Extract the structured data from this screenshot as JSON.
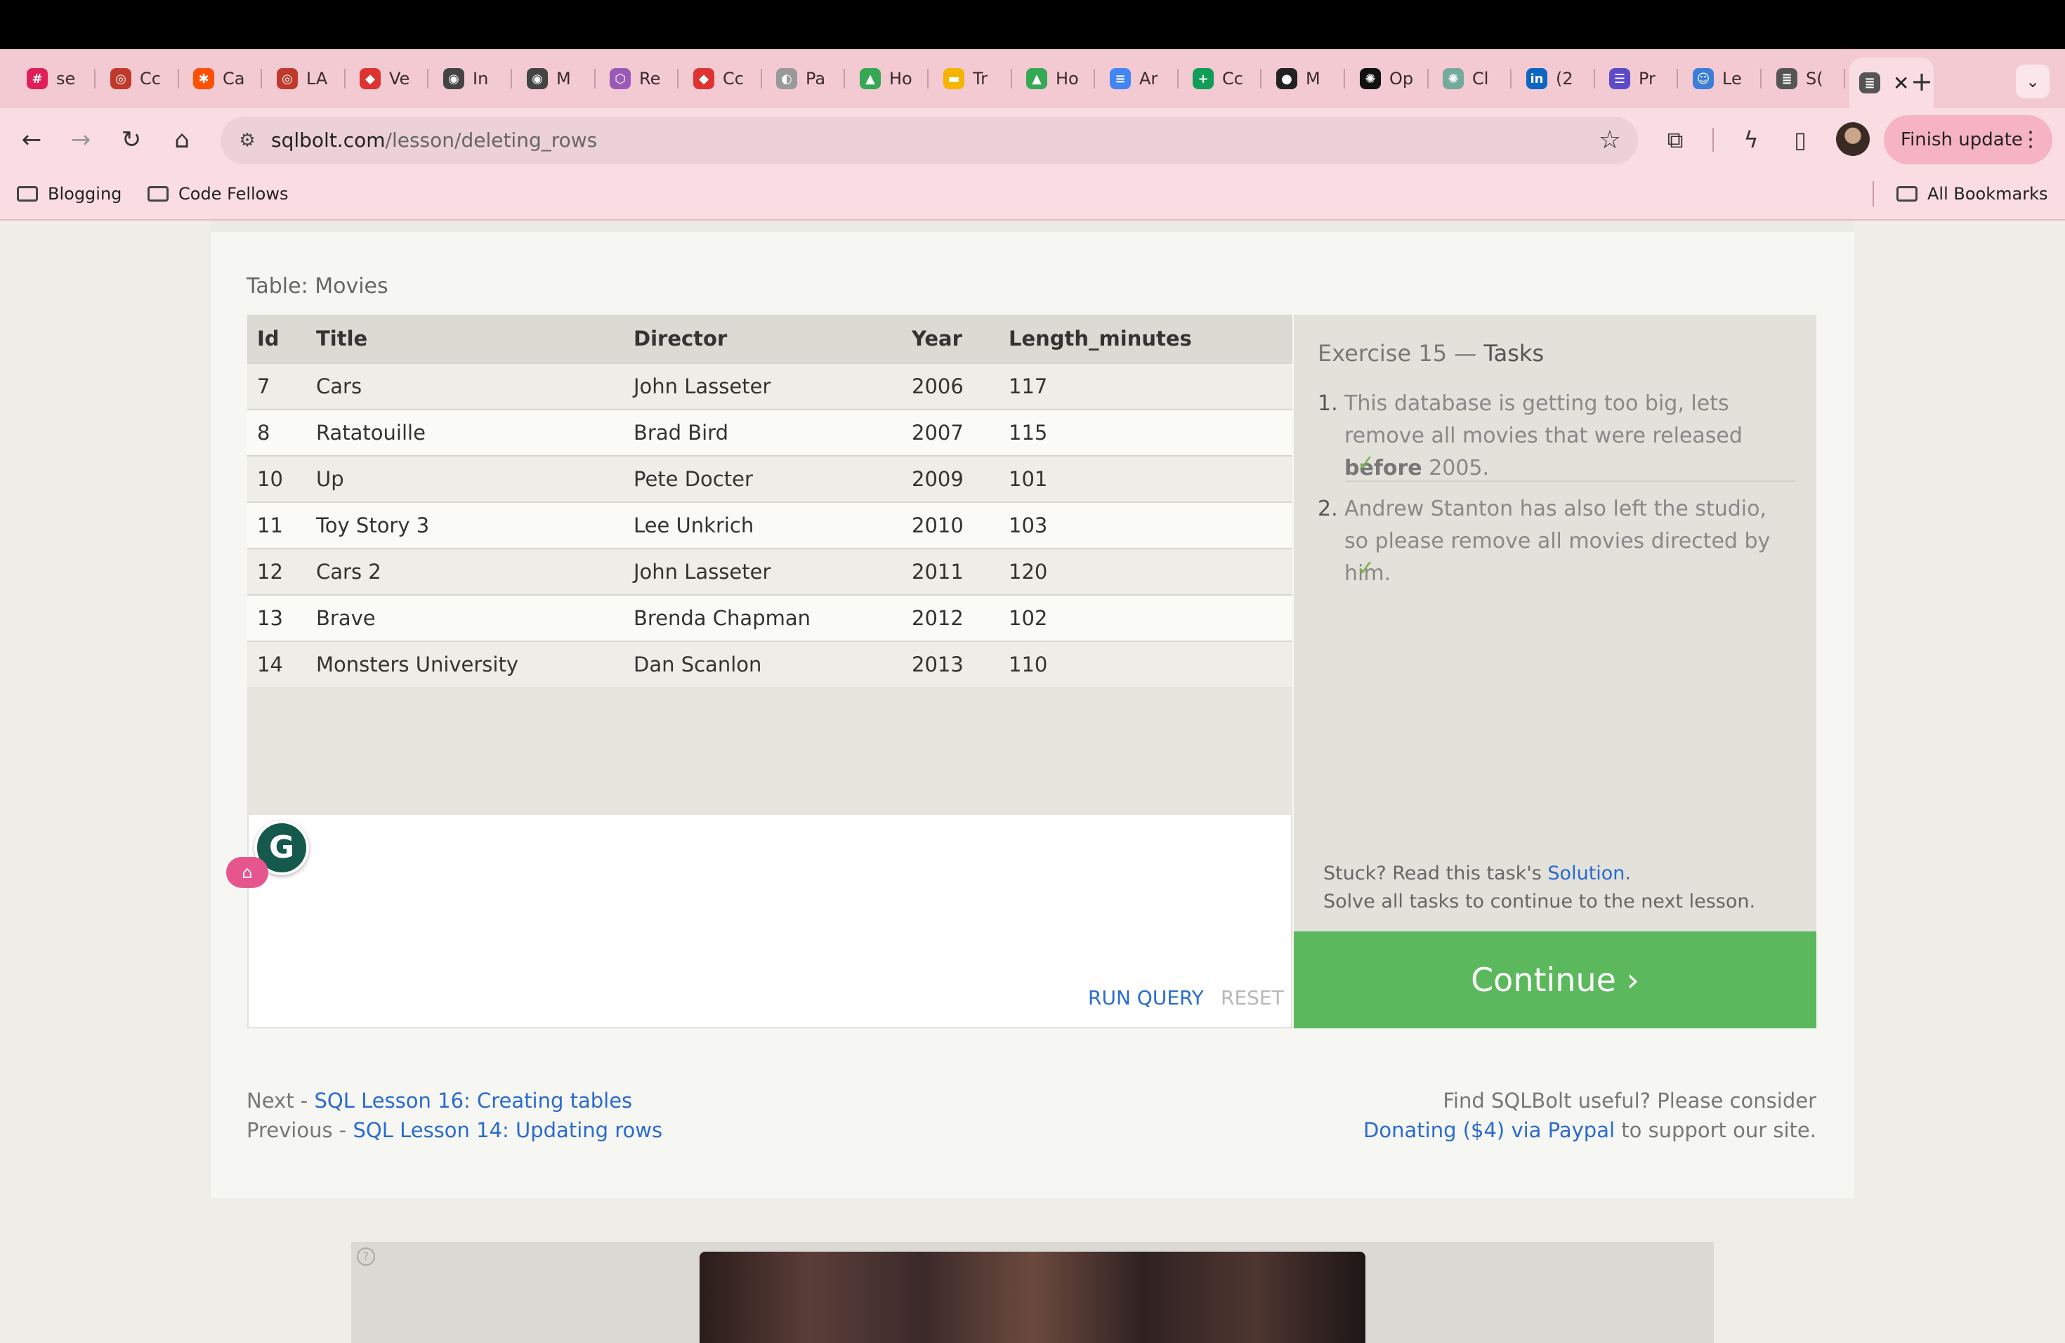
{
  "browser": {
    "tabs": [
      {
        "title": "se",
        "icon": "slack-icon",
        "color": "#e01e5a"
      },
      {
        "title": "Cc",
        "icon": "target-icon",
        "color": "#c0392b"
      },
      {
        "title": "Ca",
        "icon": "zapier-icon",
        "color": "#ff4f00"
      },
      {
        "title": "LA",
        "icon": "target-icon",
        "color": "#c0392b"
      },
      {
        "title": "Ve",
        "icon": "shield-code-icon",
        "color": "#d33"
      },
      {
        "title": "In",
        "icon": "openai-ring-icon",
        "color": "#444"
      },
      {
        "title": "M",
        "icon": "openai-ring-icon",
        "color": "#444"
      },
      {
        "title": "Re",
        "icon": "cube-icon",
        "color": "#9b59b6"
      },
      {
        "title": "Cc",
        "icon": "shield-code-icon",
        "color": "#d33"
      },
      {
        "title": "Pa",
        "icon": "globe-icon",
        "color": "#999"
      },
      {
        "title": "Ho",
        "icon": "drive-icon",
        "color": "#34a853"
      },
      {
        "title": "Tr",
        "icon": "slides-icon",
        "color": "#f4b400"
      },
      {
        "title": "Ho",
        "icon": "drive-icon",
        "color": "#34a853"
      },
      {
        "title": "Ar",
        "icon": "docs-icon",
        "color": "#4285f4"
      },
      {
        "title": "Cc",
        "icon": "sheets-plus-icon",
        "color": "#0f9d58"
      },
      {
        "title": "M",
        "icon": "github-icon",
        "color": "#222"
      },
      {
        "title": "Op",
        "icon": "openai-icon",
        "color": "#111"
      },
      {
        "title": "Cl",
        "icon": "chatgpt-icon",
        "color": "#74aa9c"
      },
      {
        "title": "(2",
        "icon": "linkedin-icon",
        "color": "#0a66c2"
      },
      {
        "title": "Pr",
        "icon": "list-icon",
        "color": "#5c4bc6"
      },
      {
        "title": "Le",
        "icon": "people-icon",
        "color": "#3b7dd8"
      },
      {
        "title": "S(",
        "icon": "database-icon",
        "color": "#555"
      },
      {
        "title": "",
        "icon": "database-icon",
        "color": "#555",
        "active": true
      }
    ],
    "url_host": "sqlbolt.com",
    "url_path": "/lesson/deleting_rows",
    "finish_update": "Finish update",
    "bookmarks": [
      "Blogging",
      "Code Fellows"
    ],
    "all_bookmarks": "All Bookmarks"
  },
  "lesson": {
    "table_caption": "Table: Movies",
    "columns": [
      "Id",
      "Title",
      "Director",
      "Year",
      "Length_minutes"
    ],
    "rows": [
      [
        "7",
        "Cars",
        "John Lasseter",
        "2006",
        "117"
      ],
      [
        "8",
        "Ratatouille",
        "Brad Bird",
        "2007",
        "115"
      ],
      [
        "10",
        "Up",
        "Pete Docter",
        "2009",
        "101"
      ],
      [
        "11",
        "Toy Story 3",
        "Lee Unkrich",
        "2010",
        "103"
      ],
      [
        "12",
        "Cars 2",
        "John Lasseter",
        "2011",
        "120"
      ],
      [
        "13",
        "Brave",
        "Brenda Chapman",
        "2012",
        "102"
      ],
      [
        "14",
        "Monsters University",
        "Dan Scanlon",
        "2013",
        "110"
      ]
    ],
    "run_query": "RUN QUERY",
    "reset": "RESET",
    "tasks": {
      "title_prefix": "Exercise 15 — ",
      "title_strong": "Tasks",
      "task1_num": "1.",
      "task1_a": "This database is getting too big, lets remove all movies that were released ",
      "task1_bold": "before",
      "task1_b": " 2005.",
      "task2_num": "2.",
      "task2": "Andrew Stanton has also left the studio, so please remove all movies directed by him.",
      "check": "✓",
      "stuck_a": "Stuck? Read this task's ",
      "stuck_link": "Solution",
      "stuck_b": ".",
      "stuck_line2": "Solve all tasks to continue to the next lesson."
    },
    "continue": "Continue ›",
    "next_label": "Next - ",
    "next_link": "SQL Lesson 16: Creating tables",
    "prev_label": "Previous - ",
    "prev_link": "SQL Lesson 14: Updating rows",
    "donate_line1": "Find SQLBolt useful? Please consider",
    "donate_link": "Donating ($4) via Paypal",
    "donate_line2": " to support our site."
  },
  "colors": {
    "accent": "#2a6bcf",
    "continue": "#5cb85c",
    "check": "#7bb34d",
    "chrome": "#f9dde3"
  }
}
